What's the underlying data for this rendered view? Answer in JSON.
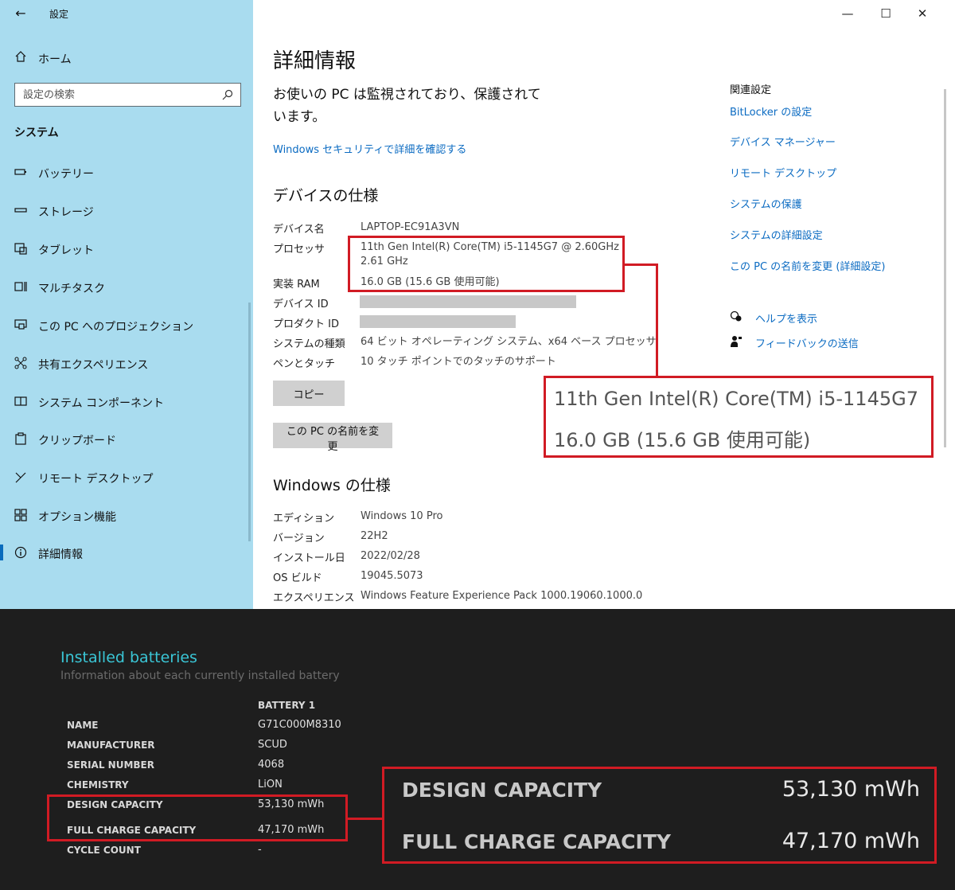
{
  "window": {
    "app_title": "設定",
    "back_glyph": "←",
    "minimize_glyph": "—",
    "maximize_glyph": "☐",
    "close_glyph": "✕"
  },
  "sidebar": {
    "home": "ホーム",
    "search_placeholder": "設定の検索",
    "section": "システム",
    "items": [
      {
        "label": "バッテリー",
        "icon": "battery-icon"
      },
      {
        "label": "ストレージ",
        "icon": "storage-icon"
      },
      {
        "label": "タブレット",
        "icon": "tablet-icon"
      },
      {
        "label": "マルチタスク",
        "icon": "multitask-icon"
      },
      {
        "label": "この PC へのプロジェクション",
        "icon": "projection-icon"
      },
      {
        "label": "共有エクスペリエンス",
        "icon": "shared-experience-icon"
      },
      {
        "label": "システム コンポーネント",
        "icon": "system-components-icon"
      },
      {
        "label": "クリップボード",
        "icon": "clipboard-icon"
      },
      {
        "label": "リモート デスクトップ",
        "icon": "remote-desktop-icon"
      },
      {
        "label": "オプション機能",
        "icon": "optional-features-icon"
      },
      {
        "label": "詳細情報",
        "icon": "info-icon"
      }
    ]
  },
  "main": {
    "title": "詳細情報",
    "protect_msg": "お使いの PC は監視されており、保護されています。",
    "security_link": "Windows セキュリティで詳細を確認する",
    "device_specs_title": "デバイスの仕様",
    "device_specs": {
      "device_name_label": "デバイス名",
      "device_name": "LAPTOP-EC91A3VN",
      "processor_label": "プロセッサ",
      "processor_line1": "11th Gen Intel(R) Core(TM) i5-1145G7 @ 2.60GHz",
      "processor_line2": "2.61 GHz",
      "ram_label": "実装 RAM",
      "ram": "16.0 GB (15.6 GB 使用可能)",
      "device_id_label": "デバイス ID",
      "product_id_label": "プロダクト ID",
      "system_type_label": "システムの種類",
      "system_type": "64 ビット オペレーティング システム、x64 ベース プロセッサ",
      "pen_touch_label": "ペンとタッチ",
      "pen_touch": "10 タッチ ポイントでのタッチのサポート"
    },
    "copy_button": "コピー",
    "rename_button": "この PC の名前を変更",
    "windows_specs_title": "Windows の仕様",
    "windows_specs": {
      "edition_label": "エディション",
      "edition": "Windows 10 Pro",
      "version_label": "バージョン",
      "version": "22H2",
      "install_date_label": "インストール日",
      "install_date": "2022/02/28",
      "os_build_label": "OS ビルド",
      "os_build": "19045.5073",
      "experience_label": "エクスペリエンス",
      "experience": "Windows Feature Experience Pack 1000.19060.1000.0"
    },
    "related": {
      "title": "関連設定",
      "links": [
        "BitLocker の設定",
        "デバイス マネージャー",
        "リモート デスクトップ",
        "システムの保護",
        "システムの詳細設定",
        "この PC の名前を変更 (詳細設定)"
      ],
      "help": "ヘルプを表示",
      "feedback": "フィードバックの送信"
    },
    "zoom_callout": {
      "line1": "11th Gen Intel(R) Core(TM) i5-1145G7",
      "line2": "16.0 GB (15.6 GB 使用可能)"
    }
  },
  "battery": {
    "title": "Installed batteries",
    "subtitle": "Information about each currently installed battery",
    "column": "BATTERY 1",
    "rows": [
      {
        "label": "NAME",
        "value": "G71C000M8310"
      },
      {
        "label": "MANUFACTURER",
        "value": "SCUD"
      },
      {
        "label": "SERIAL NUMBER",
        "value": "4068"
      },
      {
        "label": "CHEMISTRY",
        "value": "LiON"
      },
      {
        "label": "DESIGN CAPACITY",
        "value": "53,130 mWh"
      },
      {
        "label": "FULL CHARGE CAPACITY",
        "value": "47,170 mWh"
      },
      {
        "label": "CYCLE COUNT",
        "value": "-"
      }
    ],
    "zoom_callout": {
      "design_label": "DESIGN CAPACITY",
      "design_value": "53,130 mWh",
      "full_label": "FULL CHARGE CAPACITY",
      "full_value": "47,170 mWh"
    }
  },
  "colors": {
    "sidebar_bg": "#a9dcef",
    "link": "#0b6bc2",
    "highlight": "#d11b24",
    "battery_title": "#3ac6d6",
    "battery_bg": "#1e1e1e"
  }
}
